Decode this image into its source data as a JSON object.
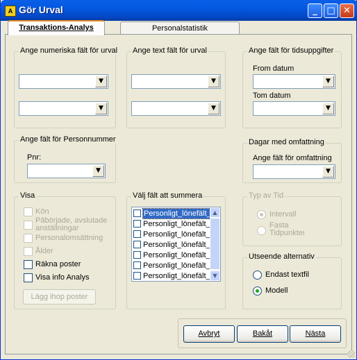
{
  "window": {
    "title": "Gör Urval",
    "icon_label": "A"
  },
  "tabs": [
    {
      "label": "Transaktions-Analys",
      "active": true
    },
    {
      "label": "Personalstatistik",
      "active": false
    }
  ],
  "groups": {
    "numeric": {
      "legend": "Ange numeriska fält för urval"
    },
    "text": {
      "legend": "Ange text fält för urval"
    },
    "time": {
      "legend": "Ange fält för tidsuppgifter",
      "from_label": "From datum",
      "to_label": "Tom datum"
    },
    "person": {
      "legend": "Ange fält för Personnummer",
      "pnr_label": "Pnr:"
    },
    "days": {
      "legend": "Dagar med omfattning",
      "field_label": "Ange fält för omfattning"
    },
    "visa": {
      "legend": "Visa",
      "items": [
        {
          "label": "Kön",
          "enabled": false,
          "checked": false
        },
        {
          "label": "Påbörjade, avslutade anställningar",
          "enabled": false,
          "checked": false
        },
        {
          "label": "Personalomsättning",
          "enabled": false,
          "checked": false
        },
        {
          "label": "Ålder",
          "enabled": false,
          "checked": false
        },
        {
          "label": "Räkna poster",
          "enabled": true,
          "checked": false
        },
        {
          "label": "Visa info Analys",
          "enabled": true,
          "checked": false
        }
      ],
      "merge_button": "Lägg ihop poster"
    },
    "sum": {
      "legend": "Välj fält att summera",
      "items": [
        "Personligt_lönefält_",
        "Personligt_lönefält_",
        "Personligt_lönefält_",
        "Personligt_lönefält_",
        "Personligt_lönefält_",
        "Personligt_lönefält_",
        "Personligt_lönefält_",
        "Personligt_lönefält_"
      ]
    },
    "timetype": {
      "legend": "Typ av Tid",
      "options": [
        "Intervall",
        "Fasta Tidpunkter"
      ],
      "selected": 0
    },
    "appearance": {
      "legend": "Utseende alternativ",
      "options": [
        "Endast textfil",
        "Modell"
      ],
      "selected": 1
    }
  },
  "buttons": {
    "cancel": "Avbryt",
    "back": "Bakåt",
    "next": "Nästa"
  }
}
